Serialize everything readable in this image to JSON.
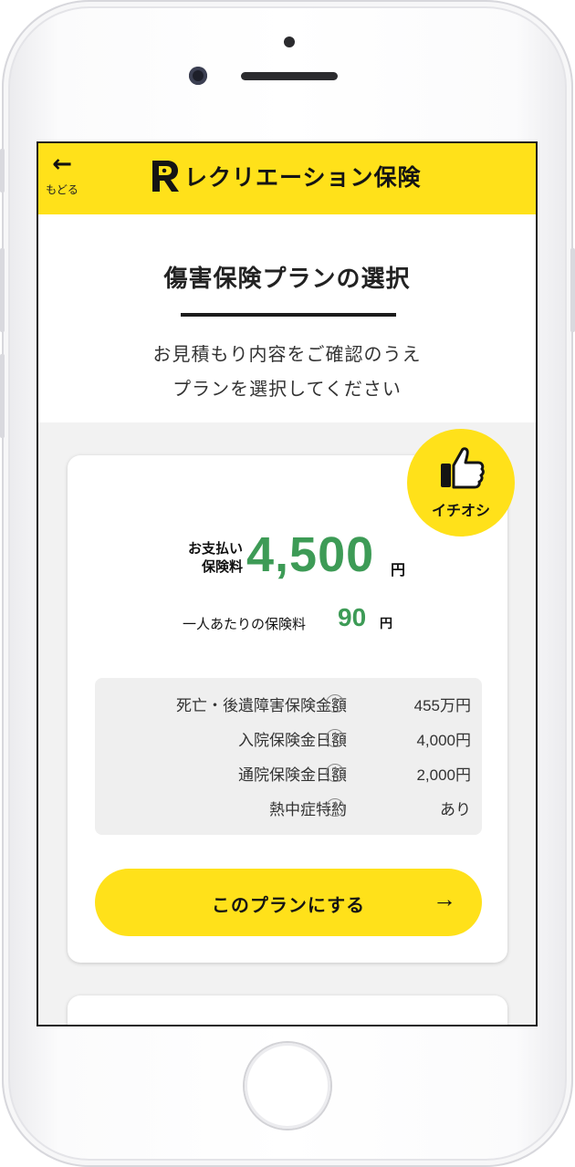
{
  "header": {
    "back_arrow": "←",
    "back_label": "もどる",
    "brand_name": "レクリエーション保険",
    "logo_icon": "r-logo-icon",
    "bg_color": "#ffe11a"
  },
  "intro": {
    "title": "傷害保険プランの選択",
    "line1": "お見積もり内容をご確認のうえ",
    "line2": "プランを選択してください"
  },
  "plan": {
    "badge_icon": "thumbs-up-icon",
    "badge_label": "イチオシ",
    "price_label_line1": "お支払い",
    "price_label_line2": "保険料",
    "price_value": "4,500",
    "price_unit": "円",
    "per_person_label": "一人あたりの保険料",
    "per_person_value": "90",
    "per_person_unit": "円",
    "accent_color": "#3d9b56",
    "details": [
      {
        "label": "死亡・後遺障害保険金額",
        "value": "455万円"
      },
      {
        "label": "入院保険金日額",
        "value": "4,000円"
      },
      {
        "label": "通院保険金日額",
        "value": "2,000円"
      },
      {
        "label": "熱中症特約",
        "value": "あり"
      }
    ],
    "help_glyph": "?",
    "cta_label": "このプランにする",
    "cta_arrow": "→"
  }
}
